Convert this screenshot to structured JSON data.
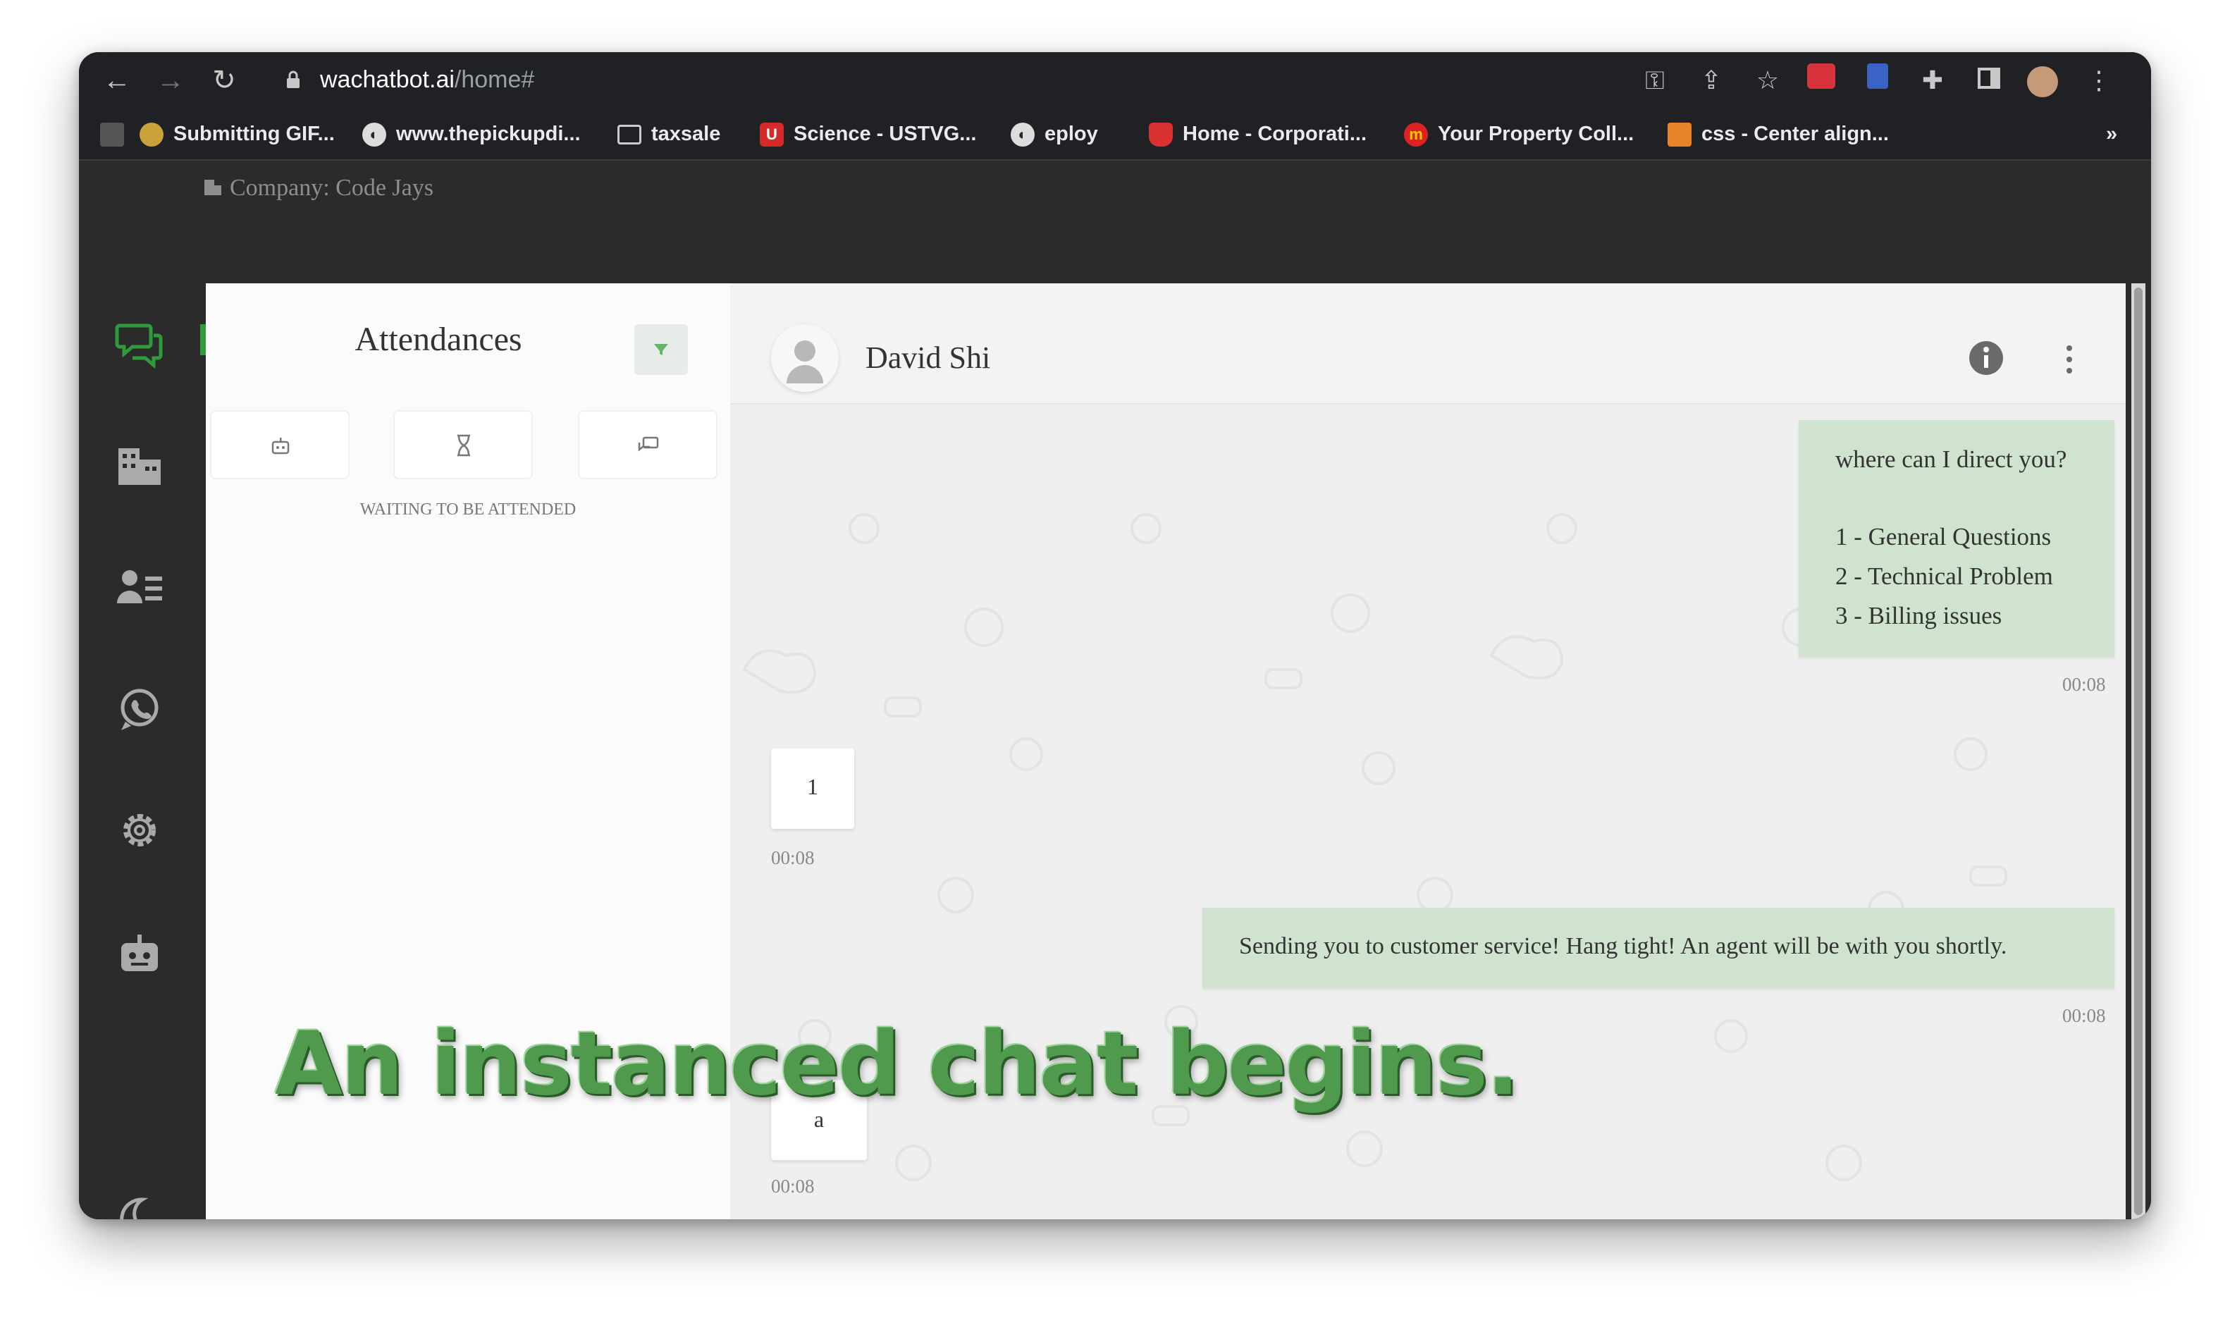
{
  "browser": {
    "url_host": "wachatbot.ai",
    "url_path": "/home#",
    "bookmarks": [
      {
        "label": "Submitting GIF...",
        "icon": "bookmark-flag-icon"
      },
      {
        "label": "www.thepickupdi...",
        "icon": "globe-icon"
      },
      {
        "label": "taxsale",
        "icon": "folder-icon"
      },
      {
        "label": "Science - USTVG...",
        "icon": "shield-u-icon"
      },
      {
        "label": "eploy",
        "icon": "globe-icon"
      },
      {
        "label": "Home - Corporati...",
        "icon": "maple-leaf-icon"
      },
      {
        "label": "Your Property Coll...",
        "icon": "m-logo-icon"
      },
      {
        "label": "css - Center align...",
        "icon": "stackoverflow-icon"
      }
    ],
    "overflow_label": "»"
  },
  "app": {
    "company": "Company: Code Jays",
    "sidebar": [
      "chat-icon",
      "building-icon",
      "contacts-icon",
      "whatsapp-icon",
      "settings-icon",
      "bot-icon",
      "moon-icon"
    ],
    "panel": {
      "title": "Attendances",
      "tabs": [
        "robot-icon",
        "hourglass-icon",
        "chat-bubble-icon"
      ],
      "waiting_label": "WAITING TO BE ATTENDED"
    },
    "chat": {
      "contact_name": "David Shi",
      "messages": [
        {
          "direction": "out",
          "lines": [
            "where can I direct you?",
            "",
            "1 - General Questions",
            "2 - Technical Problem",
            "3 - Billing issues"
          ],
          "time": "00:08"
        },
        {
          "direction": "in",
          "text": "1",
          "time": "00:08"
        },
        {
          "direction": "out",
          "lines": [
            "Sending you to customer service! Hang tight! An agent will be with you shortly."
          ],
          "time": "00:08"
        },
        {
          "direction": "in",
          "text": "a",
          "time": "00:08"
        }
      ]
    }
  },
  "caption": "An instanced chat begins.",
  "colors": {
    "accent": "#2e9c3a",
    "bubble_out": "#cfe3cf",
    "sidebar": "#2b2b2b"
  }
}
